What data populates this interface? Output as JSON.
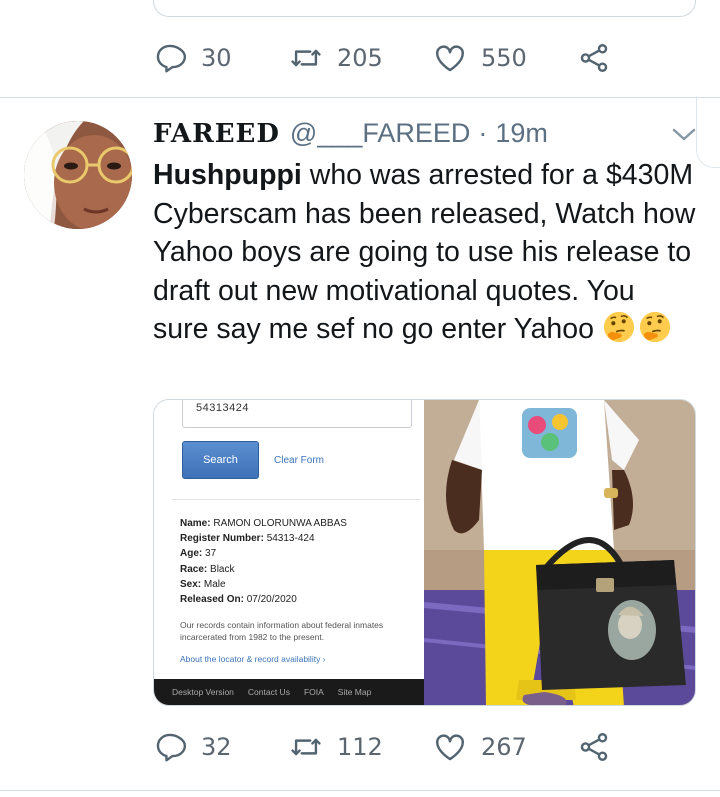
{
  "prev_tweet": {
    "actions": {
      "reply_count": "30",
      "retweet_count": "205",
      "like_count": "550"
    }
  },
  "tweet": {
    "display_name": "FAREED",
    "handle": "@___FAREED",
    "separator": "·",
    "time": "19m",
    "text_bold": "Hushpuppi",
    "text_rest": " who was arrested for a $430M Cyberscam has been released, Watch how Yahoo boys are going to use his release to draft out new motivational quotes. You sure say me sef no go enter Yahoo",
    "emoji": [
      "thinking-face",
      "thinking-face"
    ],
    "media": {
      "search_value": "54313424",
      "search_button": "Search",
      "clear_form": "Clear Form",
      "details": [
        {
          "label": "Name:",
          "value": "RAMON OLORUNWA ABBAS"
        },
        {
          "label": "Register Number:",
          "value": "54313-424"
        },
        {
          "label": "Age:",
          "value": "37"
        },
        {
          "label": "Race:",
          "value": "Black"
        },
        {
          "label": "Sex:",
          "value": "Male"
        },
        {
          "label": "Released On:",
          "value": "07/20/2020"
        }
      ],
      "note": "Our records contain information about federal inmates incarcerated from 1982 to the present.",
      "link": "About the locator & record availability ›",
      "footer": [
        "Desktop Version",
        "Contact Us",
        "FOIA",
        "Site Map"
      ]
    },
    "actions": {
      "reply_count": "32",
      "retweet_count": "112",
      "like_count": "267"
    }
  },
  "colors": {
    "icon_gray": "#536471",
    "text_gray": "#5b7083",
    "divider": "#d8dde1"
  }
}
